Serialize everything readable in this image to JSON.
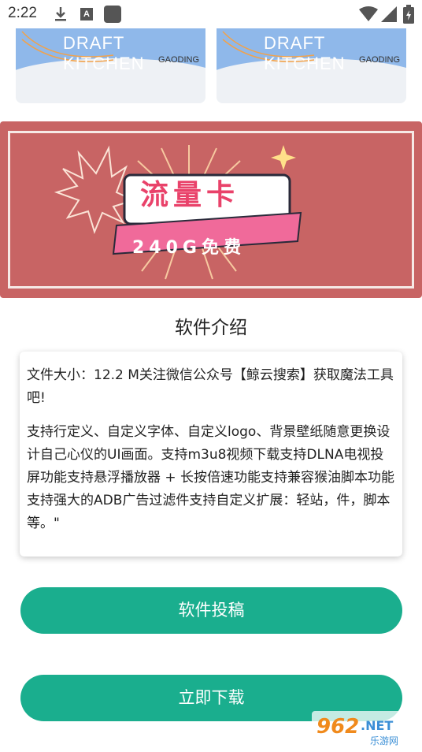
{
  "status_bar": {
    "time": "2:22",
    "icons": [
      "download-icon",
      "a-notification-icon",
      "app-square-icon",
      "wifi-icon",
      "signal-icon",
      "battery-icon"
    ]
  },
  "cards": [
    {
      "title": "DRAFT KITCHEN",
      "subtitle": "GAODING"
    },
    {
      "title": "DRAFT KITCHEN",
      "subtitle": "GAODING"
    }
  ],
  "banner": {
    "title": "流量卡",
    "subtitle": "240G免费",
    "colors": {
      "background": "#c86464",
      "title": "#e9426a",
      "ribbon": "#f06a9a"
    }
  },
  "section": {
    "title": "软件介绍"
  },
  "description": {
    "paragraph1": "文件大小：12.2 M关注微信公众号【鲸云搜索】获取魔法工具吧!",
    "paragraph2": "支持行定义、自定义字体、自定义logo、背景壁纸随意更换设计自己心仪的UI画面。支持m3u8视频下载支持DLNA电视投屏功能支持悬浮播放器 + 长按倍速功能支持兼容猴油脚本功能支持强大的ADB广告过滤件支持自定义扩展：轻站，件，脚本等。\""
  },
  "buttons": {
    "submit": "软件投稿",
    "download": "立即下载",
    "color": "#1aae8e"
  },
  "watermark": {
    "main": "962.NET",
    "sub": "乐游网"
  }
}
